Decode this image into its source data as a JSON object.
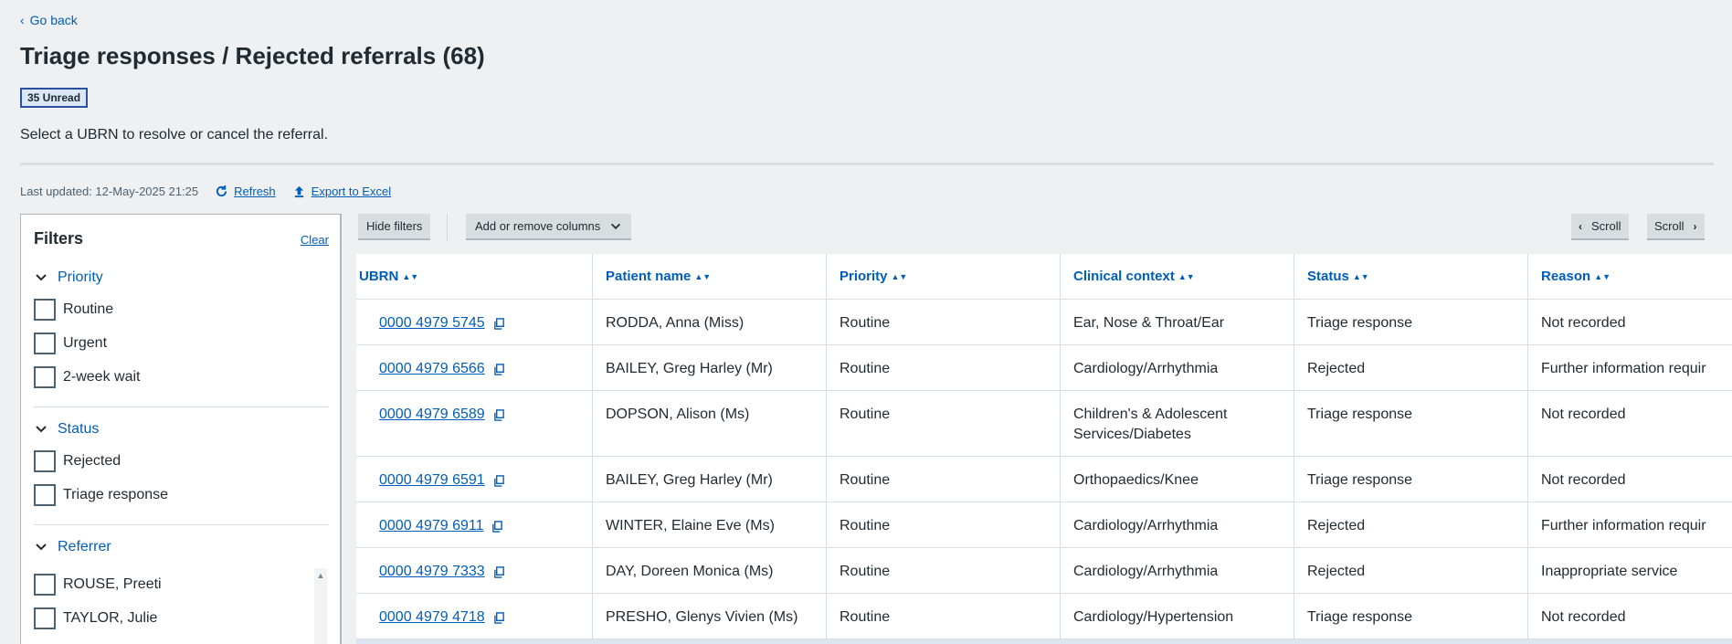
{
  "nav": {
    "back_label": "Go back"
  },
  "header": {
    "title": "Triage responses / Rejected referrals (68)",
    "unread_badge": "35 Unread",
    "instruction": "Select a UBRN to resolve or cancel the referral."
  },
  "meta": {
    "last_updated": "Last updated: 12-May-2025 21:25",
    "refresh_label": "Refresh",
    "export_label": "Export to Excel"
  },
  "filters": {
    "title": "Filters",
    "clear_label": "Clear",
    "sections": [
      {
        "label": "Priority",
        "options": [
          "Routine",
          "Urgent",
          "2-week wait"
        ]
      },
      {
        "label": "Status",
        "options": [
          "Rejected",
          "Triage response"
        ]
      },
      {
        "label": "Referrer",
        "options": [
          "ROUSE, Preeti",
          "TAYLOR, Julie"
        ]
      }
    ]
  },
  "toolbar": {
    "hide_filters": "Hide filters",
    "add_remove_columns": "Add or remove columns",
    "scroll_left": "Scroll",
    "scroll_right": "Scroll"
  },
  "table": {
    "columns": [
      "UBRN",
      "Patient name",
      "Priority",
      "Clinical context",
      "Status",
      "Reason"
    ],
    "rows": [
      {
        "ubrn": "0000 4979 5745",
        "patient": "RODDA, Anna (Miss)",
        "priority": "Routine",
        "context": "Ear, Nose & Throat/Ear",
        "status": "Triage response",
        "reason": "Not recorded"
      },
      {
        "ubrn": "0000 4979 6566",
        "patient": "BAILEY, Greg Harley (Mr)",
        "priority": "Routine",
        "context": "Cardiology/Arrhythmia",
        "status": "Rejected",
        "reason": "Further information requir"
      },
      {
        "ubrn": "0000 4979 6589",
        "patient": "DOPSON, Alison (Ms)",
        "priority": "Routine",
        "context": "Children's & Adolescent Services/Diabetes",
        "status": "Triage response",
        "reason": "Not recorded"
      },
      {
        "ubrn": "0000 4979 6591",
        "patient": "BAILEY, Greg Harley (Mr)",
        "priority": "Routine",
        "context": "Orthopaedics/Knee",
        "status": "Triage response",
        "reason": "Not recorded"
      },
      {
        "ubrn": "0000 4979 6911",
        "patient": "WINTER, Elaine Eve (Ms)",
        "priority": "Routine",
        "context": "Cardiology/Arrhythmia",
        "status": "Rejected",
        "reason": "Further information requir"
      },
      {
        "ubrn": "0000 4979 7333",
        "patient": "DAY, Doreen Monica (Ms)",
        "priority": "Routine",
        "context": "Cardiology/Arrhythmia",
        "status": "Rejected",
        "reason": "Inappropriate service"
      },
      {
        "ubrn": "0000 4979 4718",
        "patient": "PRESHO, Glenys Vivien (Ms)",
        "priority": "Routine",
        "context": "Cardiology/Hypertension",
        "status": "Triage response",
        "reason": "Not recorded"
      }
    ]
  },
  "colors": {
    "link": "#005eb8",
    "text": "#212b32",
    "page_bg": "#eef0f2",
    "border": "#d8dde0"
  }
}
